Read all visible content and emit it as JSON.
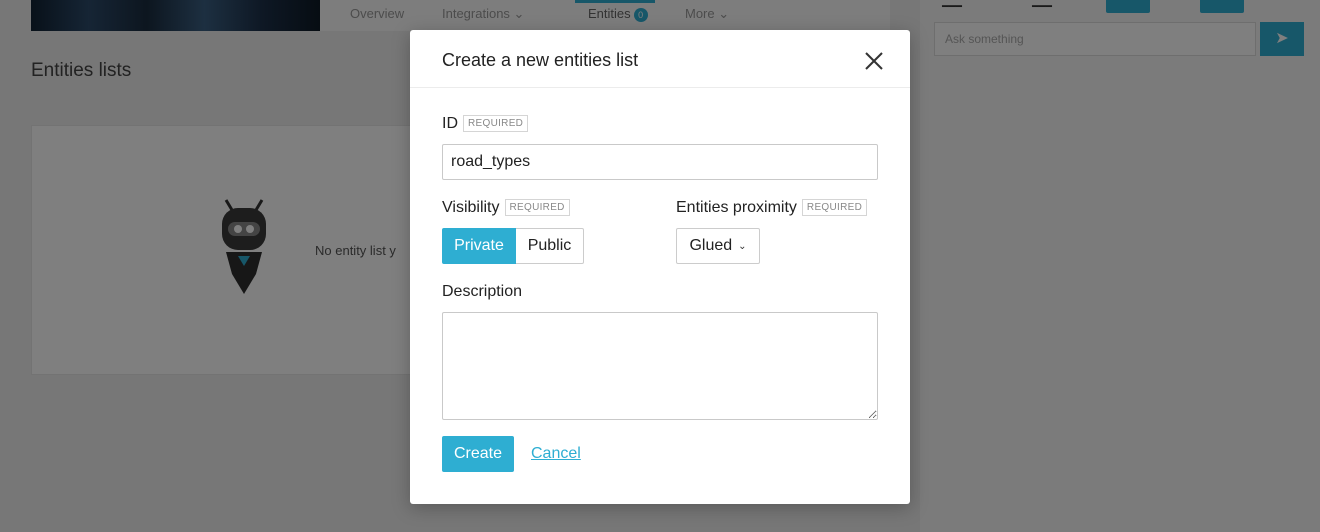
{
  "background": {
    "tabs": [
      {
        "label": "Overview"
      },
      {
        "label": "Integrations ⌄"
      },
      {
        "label": "Entities",
        "count": "0"
      },
      {
        "label": "More ⌄"
      }
    ],
    "heading": "Entities lists",
    "empty_text": "No entity list y",
    "search_placeholder": "Ask something"
  },
  "modal": {
    "title": "Create a new entities list",
    "id_label": "ID",
    "required": "REQUIRED",
    "id_value": "road_types",
    "visibility_label": "Visibility",
    "visibility_options": {
      "private": "Private",
      "public": "Public"
    },
    "visibility_selected": "Private",
    "proximity_label": "Entities proximity",
    "proximity_value": "Glued",
    "description_label": "Description",
    "description_value": "",
    "create_label": "Create",
    "cancel_label": "Cancel"
  },
  "colors": {
    "accent": "#2eaed2"
  }
}
